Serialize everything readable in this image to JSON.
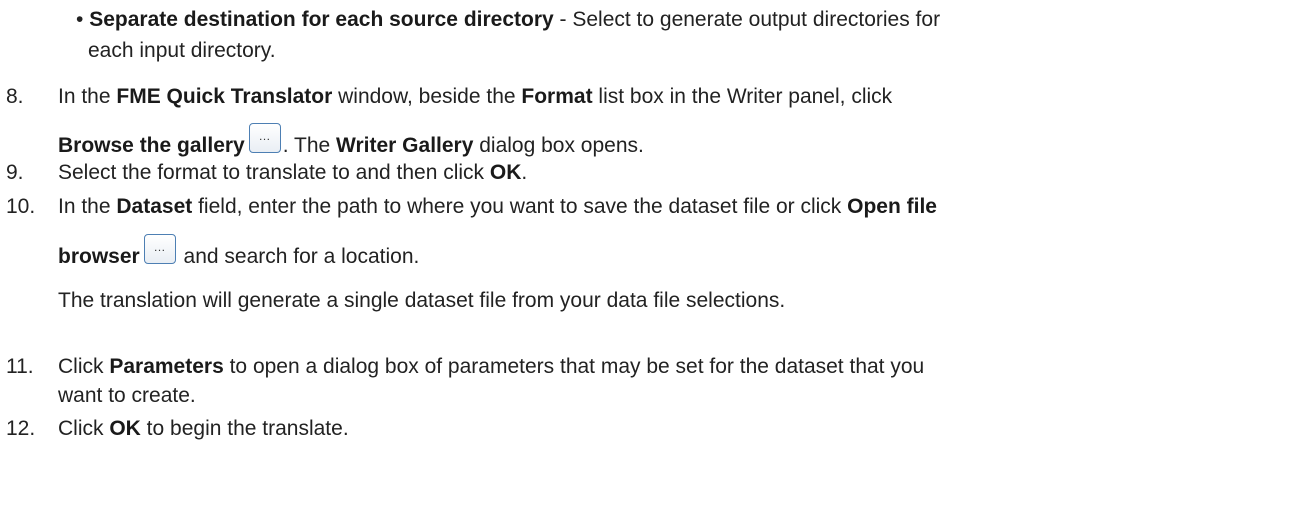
{
  "bullet": {
    "marker": "•",
    "bold": "Separate destination for each source directory",
    "text_line1": " - Select to generate output directories for",
    "text_line2": "each input directory."
  },
  "step8": {
    "number": "8.",
    "t1": "In the ",
    "b1": "FME Quick Translator",
    "t2": " window, beside the ",
    "b2": "Format",
    "t3": " list box in the Writer panel, click",
    "b3": "Browse the gallery",
    "button_glyph": "…",
    "t4": ". The ",
    "b4": "Writer Gallery",
    "t5": " dialog box opens."
  },
  "step9": {
    "number": "9.",
    "t1": "Select the format to translate to and then click ",
    "b1": "OK",
    "t2": "."
  },
  "step10": {
    "number": "10.",
    "t1": "In the ",
    "b1": "Dataset",
    "t2": " field, enter the path to where you want to save the dataset file or click ",
    "b2": "Open file",
    "b3": "browser",
    "button_glyph": "…",
    "t3": " and search for a location.",
    "note": "The translation will generate a single dataset file from your data file selections."
  },
  "step11": {
    "number": "11.",
    "t1": "Click ",
    "b1": "Parameters",
    "t2": " to open a dialog box of parameters that may be set for the dataset that you",
    "t3": "want to create."
  },
  "step12": {
    "number": "12.",
    "t1": "Click ",
    "b1": "OK",
    "t2": " to begin the translate."
  }
}
